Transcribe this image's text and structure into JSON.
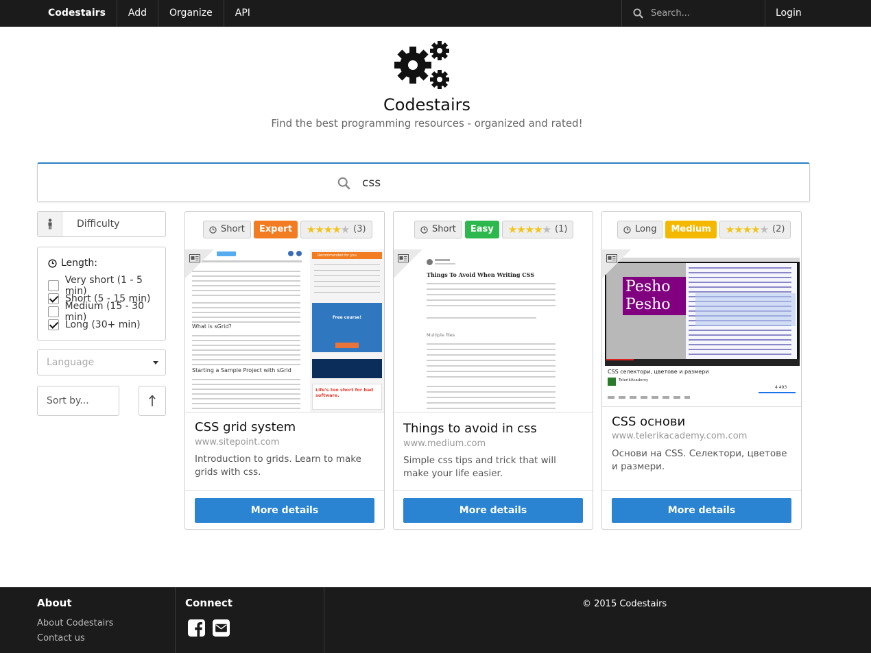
{
  "navbar": {
    "brand": "Codestairs",
    "items": [
      "Add",
      "Organize",
      "API"
    ],
    "search_placeholder": "Search...",
    "login": "Login"
  },
  "hero": {
    "title": "Codestairs",
    "subtitle": "Find the best programming resources - organized and rated!"
  },
  "main_search": {
    "value": "css"
  },
  "sidebar": {
    "difficulty_label": "Difficulty",
    "length_title": "Length:",
    "length_options": [
      {
        "label": "Very short (1 - 5 min)",
        "checked": false
      },
      {
        "label": "Short (5 - 15 min)",
        "checked": true
      },
      {
        "label": "Medium (15 - 30 min)",
        "checked": false
      },
      {
        "label": "Long (30+ min)",
        "checked": true
      }
    ],
    "language_placeholder": "Language",
    "sort_placeholder": "Sort by..."
  },
  "cards": [
    {
      "length": "Short",
      "difficulty": "Expert",
      "difficulty_color": "#f27c21",
      "rating": 4,
      "rating_count": "(3)",
      "title": "CSS grid system",
      "url": "www.sitepoint.com",
      "description": "Introduction to grids. Learn to make grids with css.",
      "button": "More details"
    },
    {
      "length": "Short",
      "difficulty": "Easy",
      "difficulty_color": "#2cb84c",
      "rating": 4,
      "rating_count": "(1)",
      "title": "Things to avoid in css",
      "url": "www.medium.com",
      "description": "Simple css tips and trick that will make your life easier.",
      "button": "More details"
    },
    {
      "length": "Long",
      "difficulty": "Medium",
      "difficulty_color": "#f5b800",
      "rating": 4,
      "rating_count": "(2)",
      "title": "CSS основи",
      "url": "www.telerikacademy.com.com",
      "description": "Основи на CSS. Селектори, цветове и размери.",
      "button": "More details"
    }
  ],
  "thumbs": {
    "sitepoint": {
      "heading1": "What is sGrid?",
      "heading2": "Starting a Sample Project with sGrid",
      "side_title": "Recommended for you",
      "promo": "Free course!",
      "ad": "Life's too short for bad software."
    },
    "medium": {
      "heading": "Things To Avoid When Writing CSS",
      "sub": "Multiple files"
    },
    "video": {
      "word": "Pesho",
      "caption": "CSS селектори, цветове и размери",
      "channel": "TelerikAcademy",
      "views": "4 493"
    }
  },
  "footer": {
    "about_title": "About",
    "about_links": [
      "About Codestairs",
      "Contact us"
    ],
    "connect_title": "Connect",
    "copyright": "© 2015 Codestairs"
  }
}
